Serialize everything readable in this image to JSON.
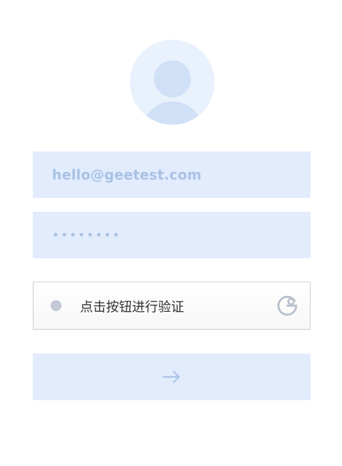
{
  "login_form": {
    "avatar_icon": "user-avatar-icon",
    "email_value": "hello@geetest.com",
    "password_value": "••••••••",
    "captcha": {
      "label": "点击按钮进行验证",
      "status_icon": "status-dot-icon",
      "logo_icon": "geetest-logo-icon"
    },
    "submit_icon": "arrow-right-icon"
  },
  "colors": {
    "field_background": "#e2ecfd",
    "field_text": "#a9c2e5",
    "avatar_background": "#e9f1fd",
    "avatar_figure": "#d0e0f6",
    "captcha_border": "#cfcfcf",
    "captcha_text": "#333333",
    "captcha_dot": "#c3cad6",
    "geetest_logo": "#b8c0cc"
  }
}
